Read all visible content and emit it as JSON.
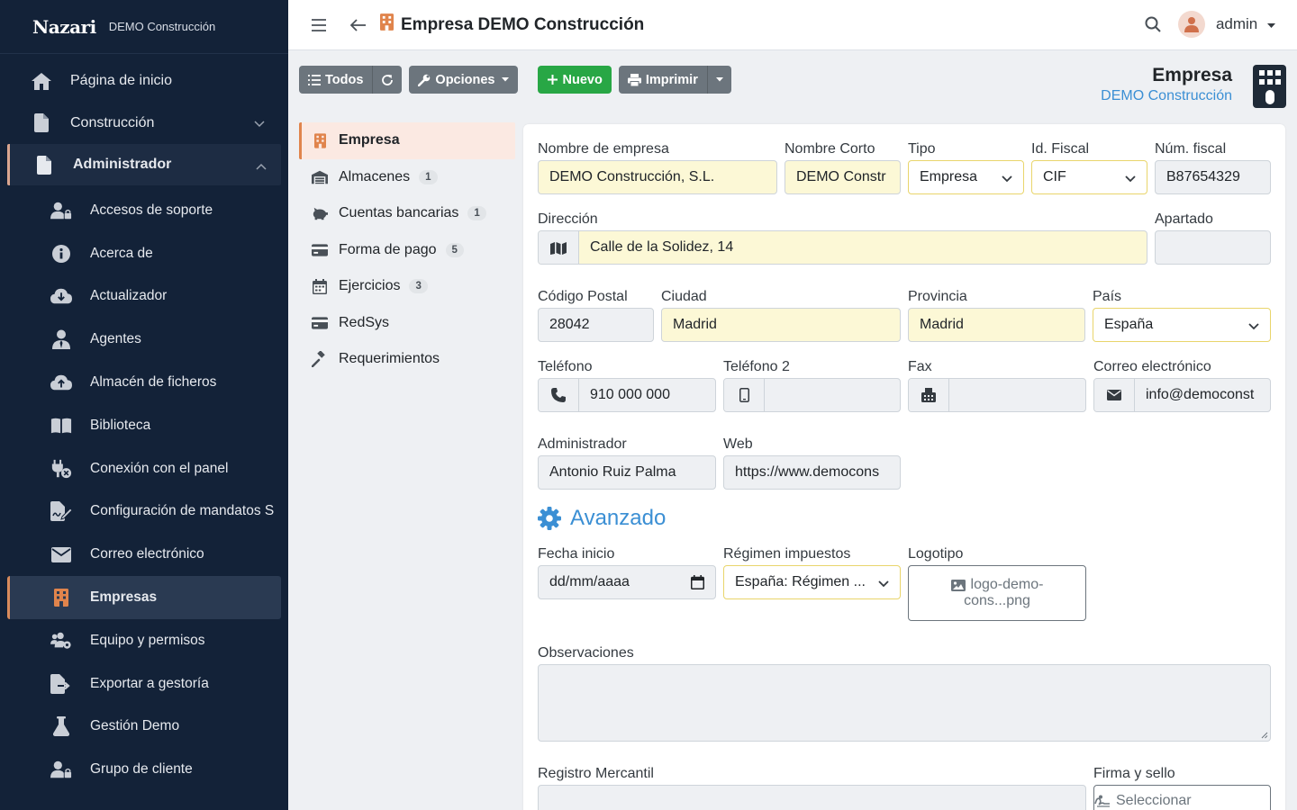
{
  "brand": {
    "logo": "Nazari",
    "subtitle": "DEMO Construcción"
  },
  "sidebar": {
    "main": [
      {
        "label": "Página de inicio",
        "icon": "home-icon"
      },
      {
        "label": "Construcción",
        "icon": "file-icon"
      },
      {
        "label": "Administrador",
        "icon": "file-icon"
      }
    ],
    "sub": [
      {
        "label": "Accesos de soporte",
        "icon": "user-lock-icon"
      },
      {
        "label": "Acerca de",
        "icon": "info-icon"
      },
      {
        "label": "Actualizador",
        "icon": "cloud-download-icon"
      },
      {
        "label": "Agentes",
        "icon": "user-tie-icon"
      },
      {
        "label": "Almacén de ficheros",
        "icon": "cloud-upload-icon"
      },
      {
        "label": "Biblioteca",
        "icon": "book-icon"
      },
      {
        "label": "Conexión con el panel",
        "icon": "plug-icon"
      },
      {
        "label": "Configuración de mandatos S",
        "icon": "signature-icon"
      },
      {
        "label": "Correo electrónico",
        "icon": "envelope-icon"
      },
      {
        "label": "Empresas",
        "icon": "building-icon"
      },
      {
        "label": "Equipo y permisos",
        "icon": "users-cog-icon"
      },
      {
        "label": "Exportar a gestoría",
        "icon": "file-export-icon"
      },
      {
        "label": "Gestión Demo",
        "icon": "flask-icon"
      },
      {
        "label": "Grupo de cliente",
        "icon": "user-lock-icon"
      }
    ]
  },
  "topbar": {
    "title": "Empresa DEMO Construcción",
    "user": "admin"
  },
  "toolbar": {
    "todos": "Todos",
    "opciones": "Opciones",
    "nuevo": "Nuevo",
    "imprimir": "Imprimir"
  },
  "header": {
    "title": "Empresa",
    "subtitle": "DEMO Construcción"
  },
  "tabs": [
    {
      "label": "Empresa",
      "badge": ""
    },
    {
      "label": "Almacenes",
      "badge": "1"
    },
    {
      "label": "Cuentas bancarias",
      "badge": "1"
    },
    {
      "label": "Forma de pago",
      "badge": "5"
    },
    {
      "label": "Ejercicios",
      "badge": "3"
    },
    {
      "label": "RedSys",
      "badge": ""
    },
    {
      "label": "Requerimientos",
      "badge": ""
    }
  ],
  "form": {
    "nombre_lbl": "Nombre de empresa",
    "nombre": "DEMO Construcción, S.L.",
    "corto_lbl": "Nombre Corto",
    "corto": "DEMO Constr",
    "tipo_lbl": "Tipo",
    "tipo": "Empresa",
    "idfiscal_lbl": "Id. Fiscal",
    "idfiscal": "CIF",
    "numfiscal_lbl": "Núm. fiscal",
    "numfiscal": "B87654329",
    "direccion_lbl": "Dirección",
    "direccion": "Calle de la Solidez, 14",
    "apartado_lbl": "Apartado",
    "apartado": "",
    "cp_lbl": "Código Postal",
    "cp": "28042",
    "ciudad_lbl": "Ciudad",
    "ciudad": "Madrid",
    "provincia_lbl": "Provincia",
    "provincia": "Madrid",
    "pais_lbl": "País",
    "pais": "España",
    "telefono_lbl": "Teléfono",
    "telefono": "910 000 000",
    "telefono2_lbl": "Teléfono 2",
    "telefono2": "",
    "fax_lbl": "Fax",
    "fax": "",
    "correo_lbl": "Correo electrónico",
    "correo": "info@democonst",
    "admin_lbl": "Administrador",
    "admin": "Antonio Ruiz Palma",
    "web_lbl": "Web",
    "web": "https://www.democons",
    "avanzado": "Avanzado",
    "fecha_lbl": "Fecha inicio",
    "fecha": "dd/mm/aaaa",
    "regimen_lbl": "Régimen impuestos",
    "regimen": "España: Régimen ...",
    "logotipo_lbl": "Logotipo",
    "logotipo_1": "logo-demo-",
    "logotipo_2": "cons...png",
    "obs_lbl": "Observaciones",
    "registro_lbl": "Registro Mercantil",
    "firma_lbl": "Firma y sello",
    "firma_btn": "Seleccionar"
  },
  "colors": {
    "sidebar": "#132238",
    "accent": "#e0844c",
    "link": "#3b8fd4",
    "highlight": "#fcf8d6"
  }
}
